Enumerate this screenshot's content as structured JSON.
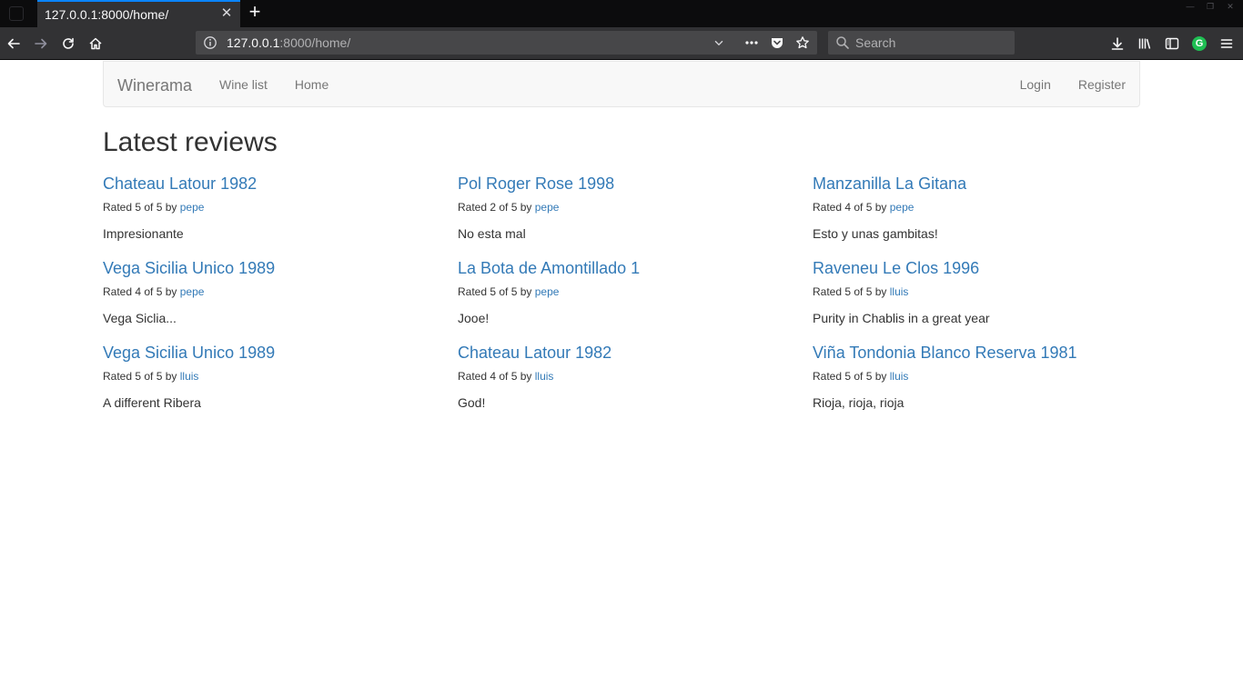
{
  "browser": {
    "tab_title": "127.0.0.1:8000/home/",
    "url_host": "127.0.0.1",
    "url_rest": ":8000/home/",
    "search_placeholder": "Search"
  },
  "site": {
    "brand": "Winerama",
    "nav_left": [
      "Wine list",
      "Home"
    ],
    "nav_right": [
      "Login",
      "Register"
    ]
  },
  "heading": "Latest reviews",
  "reviews": [
    {
      "wine": "Chateau Latour 1982",
      "rated_prefix": "Rated 5 of 5 by ",
      "user": "pepe",
      "comment": "Impresionante"
    },
    {
      "wine": "Pol Roger Rose 1998",
      "rated_prefix": "Rated 2 of 5 by ",
      "user": "pepe",
      "comment": "No esta mal"
    },
    {
      "wine": "Manzanilla La Gitana",
      "rated_prefix": "Rated 4 of 5 by ",
      "user": "pepe",
      "comment": "Esto y unas gambitas!"
    },
    {
      "wine": "Vega Sicilia Unico 1989",
      "rated_prefix": "Rated 4 of 5 by ",
      "user": "pepe",
      "comment": "Vega Siclia..."
    },
    {
      "wine": "La Bota de Amontillado 1",
      "rated_prefix": "Rated 5 of 5 by ",
      "user": "pepe",
      "comment": "Jooe!"
    },
    {
      "wine": "Raveneu Le Clos 1996",
      "rated_prefix": "Rated 5 of 5 by ",
      "user": "lluis",
      "comment": "Purity in Chablis in a great year"
    },
    {
      "wine": "Vega Sicilia Unico 1989",
      "rated_prefix": "Rated 5 of 5 by ",
      "user": "lluis",
      "comment": "A different Ribera"
    },
    {
      "wine": "Chateau Latour 1982",
      "rated_prefix": "Rated 4 of 5 by ",
      "user": "lluis",
      "comment": "God!"
    },
    {
      "wine": "Viña Tondonia Blanco Reserva 1981",
      "rated_prefix": "Rated 5 of 5 by ",
      "user": "lluis",
      "comment": "Rioja, rioja, rioja"
    }
  ]
}
